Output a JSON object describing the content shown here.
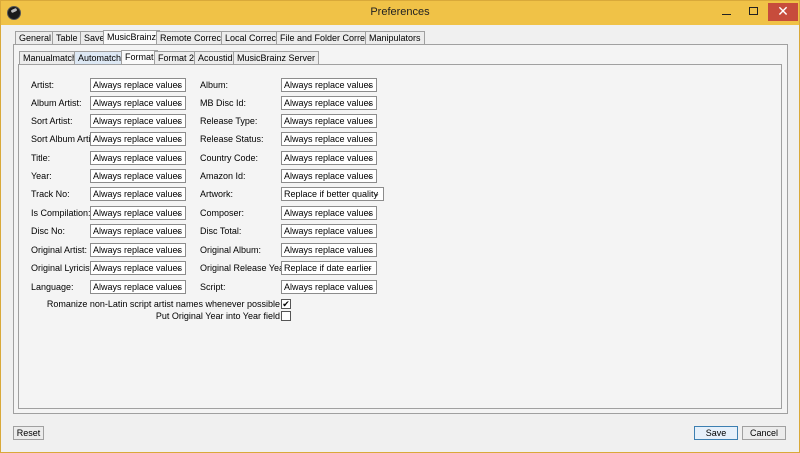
{
  "window": {
    "title": "Preferences",
    "minimize_label": "",
    "close_label": "✕"
  },
  "main_tabs": [
    "General",
    "Table",
    "Save",
    "MusicBrainz",
    "Remote Correct",
    "Local Correct",
    "File and Folder Correct",
    "Manipulators"
  ],
  "sub_tabs": [
    "Manualmatch",
    "Automatch",
    "Format",
    "Format 2",
    "Acoustid",
    "MusicBrainz Server"
  ],
  "left_fields": [
    {
      "label": "Artist:",
      "value": "Always replace values"
    },
    {
      "label": "Album Artist:",
      "value": "Always replace values"
    },
    {
      "label": "Sort Artist:",
      "value": "Always replace values"
    },
    {
      "label": "Sort Album Artist:",
      "value": "Always replace values"
    },
    {
      "label": "Title:",
      "value": "Always replace values"
    },
    {
      "label": "Year:",
      "value": "Always replace values"
    },
    {
      "label": "Track No:",
      "value": "Always replace values"
    },
    {
      "label": "Is Compilation:",
      "value": "Always replace values"
    },
    {
      "label": "Disc No:",
      "value": "Always replace values"
    },
    {
      "label": "Original Artist:",
      "value": "Always replace values"
    },
    {
      "label": "Original Lyricist:",
      "value": "Always replace values"
    },
    {
      "label": "Language:",
      "value": "Always replace values"
    }
  ],
  "right_fields": [
    {
      "label": "Album:",
      "value": "Always replace values"
    },
    {
      "label": "MB Disc Id:",
      "value": "Always replace values"
    },
    {
      "label": "Release Type:",
      "value": "Always replace values"
    },
    {
      "label": "Release Status:",
      "value": "Always replace values"
    },
    {
      "label": "Country Code:",
      "value": "Always replace values"
    },
    {
      "label": "Amazon Id:",
      "value": "Always replace values"
    },
    {
      "label": "Artwork:",
      "value": "Replace if better quality"
    },
    {
      "label": "Composer:",
      "value": "Always replace values"
    },
    {
      "label": "Disc Total:",
      "value": "Always replace values"
    },
    {
      "label": "Original Album:",
      "value": "Always replace values"
    },
    {
      "label": "Original Release Year:",
      "value": "Replace if date earlier"
    },
    {
      "label": "Script:",
      "value": "Always replace values"
    }
  ],
  "options": [
    {
      "label": "Romanize non-Latin script artist names whenever possible",
      "checked": true,
      "mark": "✔"
    },
    {
      "label": "Put Original Year into Year field",
      "checked": false,
      "mark": ""
    }
  ],
  "buttons": {
    "reset": "Reset",
    "save": "Save",
    "cancel": "Cancel"
  }
}
